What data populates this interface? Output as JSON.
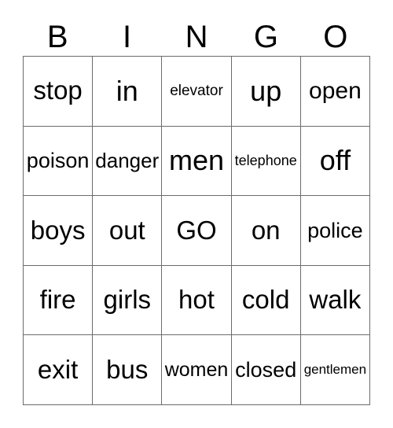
{
  "card": {
    "header": {
      "letters": [
        "B",
        "I",
        "N",
        "G",
        "O"
      ]
    },
    "grid": {
      "columns": 5,
      "rows": 5,
      "free_space_label": "GO",
      "cells": [
        [
          {
            "label": "stop",
            "size": "lg"
          },
          {
            "label": "in",
            "size": "xl"
          },
          {
            "label": "elevator",
            "size": "xs"
          },
          {
            "label": "up",
            "size": "xl"
          },
          {
            "label": "open",
            "size": "md"
          }
        ],
        [
          {
            "label": "poison",
            "size": "sm"
          },
          {
            "label": "danger",
            "size": "sm"
          },
          {
            "label": "men",
            "size": "xl"
          },
          {
            "label": "telephone",
            "size": "xxs"
          },
          {
            "label": "off",
            "size": "xl"
          }
        ],
        [
          {
            "label": "boys",
            "size": "lg"
          },
          {
            "label": "out",
            "size": "lg"
          },
          {
            "label": "GO",
            "size": "lg"
          },
          {
            "label": "on",
            "size": "lg"
          },
          {
            "label": "police",
            "size": "sm"
          }
        ],
        [
          {
            "label": "fire",
            "size": "lg"
          },
          {
            "label": "girls",
            "size": "lg"
          },
          {
            "label": "hot",
            "size": "lg"
          },
          {
            "label": "cold",
            "size": "lg"
          },
          {
            "label": "walk",
            "size": "lg"
          }
        ],
        [
          {
            "label": "exit",
            "size": "lg"
          },
          {
            "label": "bus",
            "size": "lg"
          },
          {
            "label": "women",
            "size": "sm"
          },
          {
            "label": "closed",
            "size": "sm"
          },
          {
            "label": "gentlemen",
            "size": "xxxs"
          }
        ]
      ]
    },
    "colors": {
      "background": "#ffffff",
      "text": "#000000",
      "grid_line": "#6b6b6b"
    }
  }
}
